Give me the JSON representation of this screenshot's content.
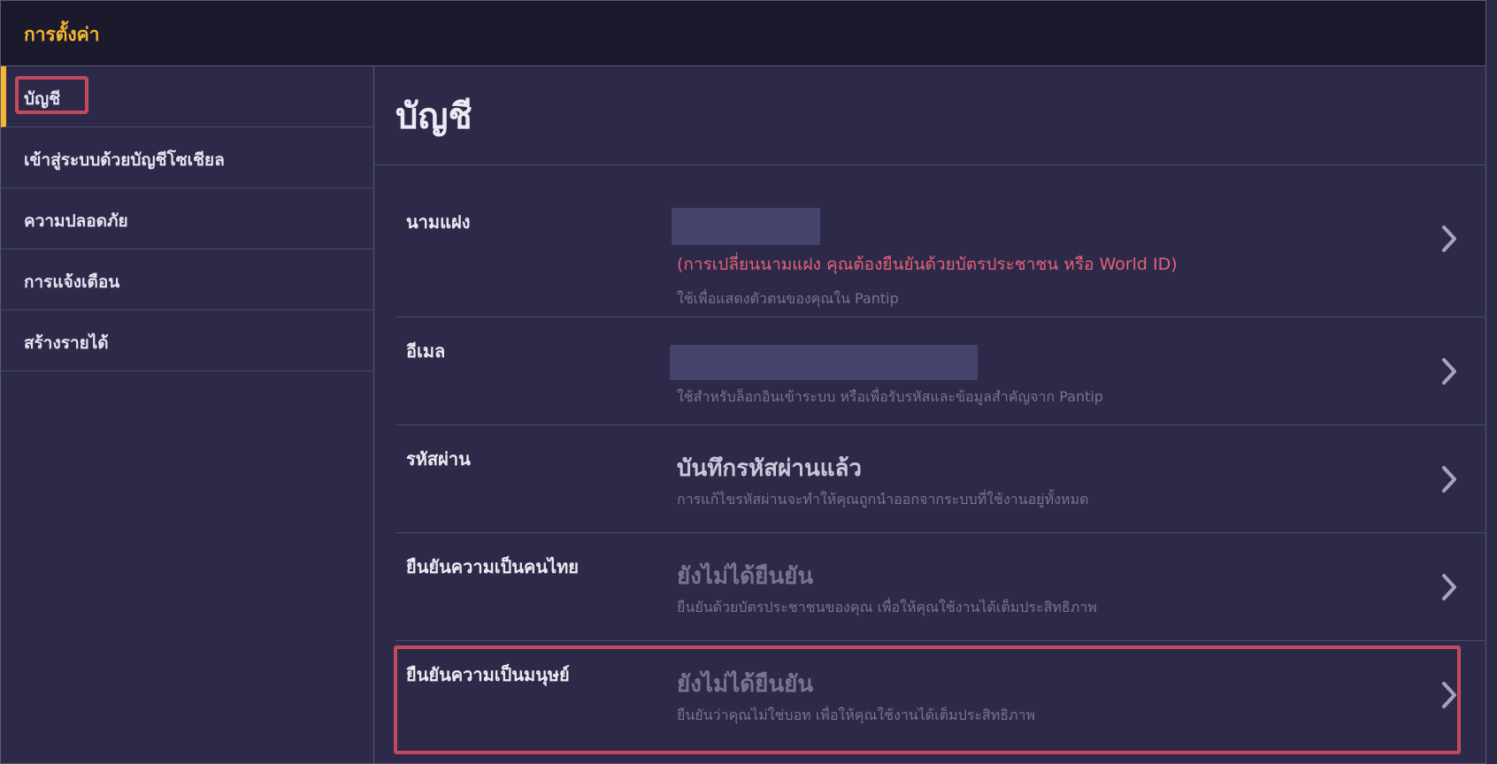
{
  "header": {
    "title": "การตั้งค่า"
  },
  "sidebar": {
    "items": [
      {
        "label": "บัญชี"
      },
      {
        "label": "เข้าสู่ระบบด้วยบัญชีโซเชียล"
      },
      {
        "label": "ความปลอดภัย"
      },
      {
        "label": "การแจ้งเตือน"
      },
      {
        "label": "สร้างรายได้"
      }
    ]
  },
  "main": {
    "title": "บัญชี",
    "rows": {
      "alias": {
        "label": "นามแฝง",
        "warning": "(การเปลี่ยนนามแฝง คุณต้องยืนยันด้วยบัตรประชาชน หรือ World ID)",
        "note": "ใช้เพื่อแสดงตัวตนของคุณใน Pantip"
      },
      "email": {
        "label": "อีเมล",
        "note": "ใช้สำหรับล็อกอินเข้าระบบ หรือเพื่อรับรหัสและข้อมูลสำคัญจาก Pantip"
      },
      "password": {
        "label": "รหัสผ่าน",
        "value": "บันทึกรหัสผ่านแล้ว",
        "note": "การแก้ไขรหัสผ่านจะทำให้คุณถูกนำออกจากระบบที่ใช้งานอยู่ทั้งหมด"
      },
      "thai_verify": {
        "label": "ยืนยันความเป็นคนไทย",
        "value": "ยังไม่ได้ยืนยัน",
        "note": "ยืนยันด้วยบัตรประชาชนของคุณ เพื่อให้คุณใช้งานได้เต็มประสิทธิภาพ"
      },
      "human_verify": {
        "label": "ยืนยันความเป็นมนุษย์",
        "value": "ยังไม่ได้ยืนยัน",
        "note": "ยืนยันว่าคุณไม่ใช่บอท เพื่อให้คุณใช้งานได้เต็มประสิทธิภาพ"
      }
    }
  },
  "colors": {
    "accent": "#f5b731",
    "background": "#2c2a48",
    "header_bg": "#1b1a2c",
    "warning": "#e8607a",
    "highlight": "#c24a5e"
  },
  "icons": {
    "row_arrow": "chevron-right-icon"
  }
}
